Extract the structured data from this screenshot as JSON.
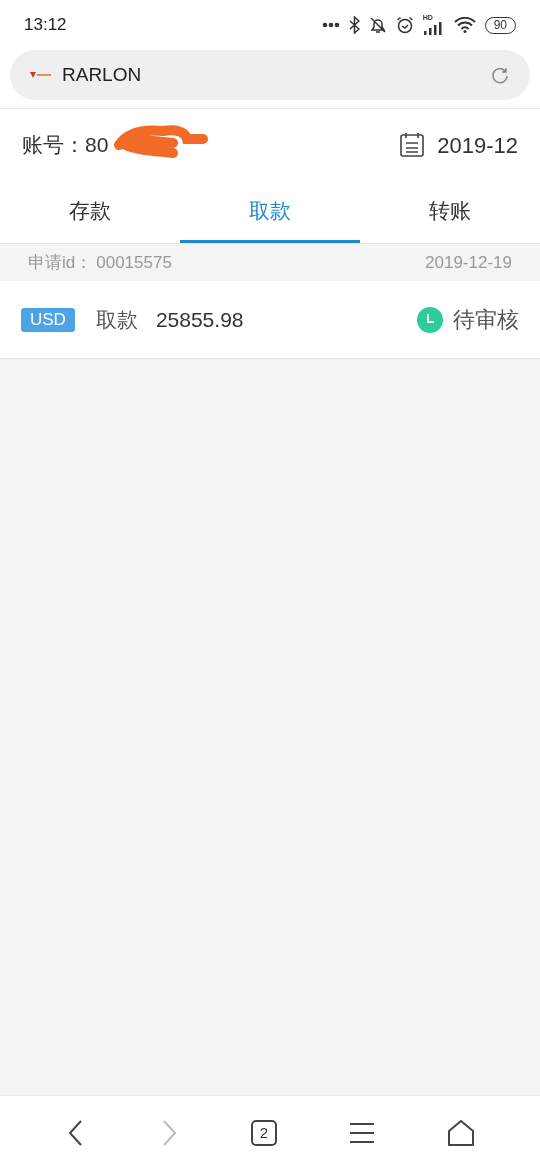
{
  "status_bar": {
    "time": "13:12",
    "network_label": "HD",
    "battery": "90"
  },
  "address_bar": {
    "site": "RARLON"
  },
  "account": {
    "label": "账号：",
    "number": "80",
    "redacted": true
  },
  "period": "2019-12",
  "tabs": [
    {
      "label": "存款",
      "selected": false
    },
    {
      "label": "取款",
      "selected": true
    },
    {
      "label": "转账",
      "selected": false
    }
  ],
  "records": [
    {
      "id_label": "申请id：",
      "id": "00015575",
      "date": "2019-12-19",
      "currency": "USD",
      "type": "取款",
      "amount": "25855.98",
      "status": "待审核",
      "color": "#2ecc9a"
    }
  ],
  "bottom_nav": {
    "back_disabled": false,
    "forward_disabled": true,
    "tab_count": "2"
  }
}
